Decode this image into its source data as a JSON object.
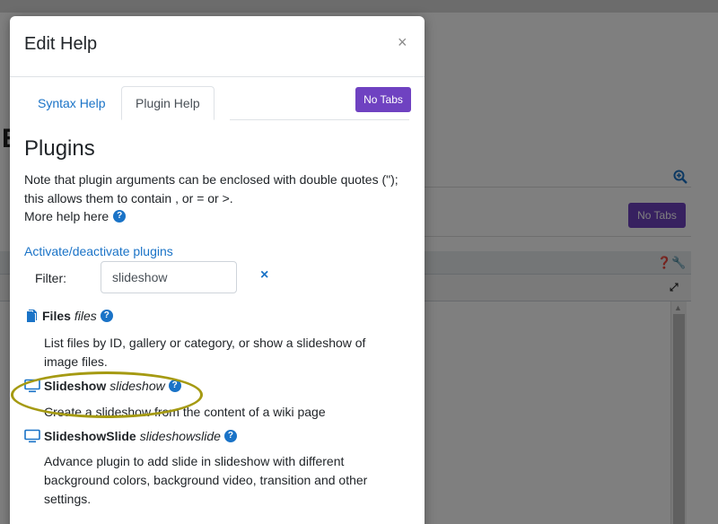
{
  "background": {
    "title_char": "E",
    "no_tabs_label": "No Tabs",
    "toolbar_icons": "❓🔧",
    "expand_icon": "⤢"
  },
  "modal": {
    "title": "Edit Help",
    "close_label": "×",
    "tabs": [
      {
        "label": "Syntax Help",
        "active": false
      },
      {
        "label": "Plugin Help",
        "active": true
      }
    ],
    "no_tabs_label": "No Tabs",
    "section_title": "Plugins",
    "note": "Note that plugin arguments can be enclosed with double quotes (\"); this allows them to contain , or = or >.",
    "more_help": "More help here",
    "activate_link": "Activate/deactivate plugins",
    "filter_label": "Filter:",
    "filter_value": "slideshow",
    "clear_label": "×",
    "plugins": [
      {
        "name": "Files",
        "code": "files",
        "icon": "file-icon",
        "description": "List files by ID, gallery or category, or show a slideshow of image files."
      },
      {
        "name": "Slideshow",
        "code": "slideshow",
        "icon": "monitor-icon",
        "description": "Create a slideshow from the content of a wiki page"
      },
      {
        "name": "SlideshowSlide",
        "code": "slideshowslide",
        "icon": "monitor-icon",
        "description": "Advance plugin to add slide in slideshow with different background colors, background video, transition and other settings."
      }
    ]
  },
  "colors": {
    "accent": "#1a73c7",
    "purple_button": "#6f42c1",
    "highlight": "#a59a12"
  }
}
